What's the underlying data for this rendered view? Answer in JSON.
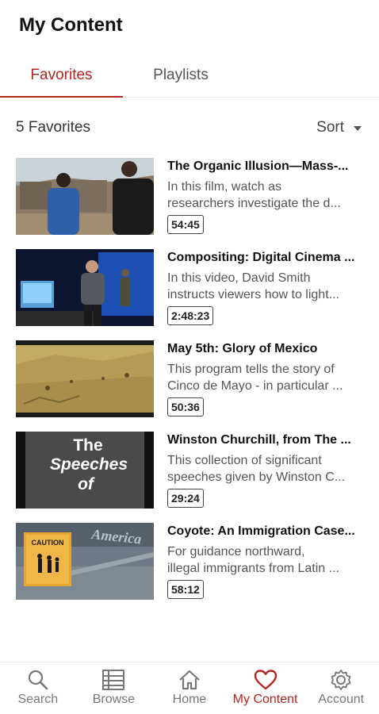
{
  "header": {
    "title": "My Content"
  },
  "tabs": [
    {
      "label": "Favorites",
      "active": true
    },
    {
      "label": "Playlists",
      "active": false
    }
  ],
  "toolbar": {
    "count_label": "5 Favorites",
    "sort_label": "Sort"
  },
  "items": [
    {
      "title": "The Organic Illusion—Mass-...",
      "desc_line1": "In this film, watch as",
      "desc_line2": "researchers investigate the d...",
      "duration": "54:45"
    },
    {
      "title": "Compositing: Digital Cinema ...",
      "desc_line1": "In this video, David Smith",
      "desc_line2": "instructs viewers how to light...",
      "duration": "2:48:23"
    },
    {
      "title": "May 5th: Glory of Mexico",
      "desc_line1": "This program tells the story of",
      "desc_line2": "Cinco de Mayo - in particular ...",
      "duration": "50:36"
    },
    {
      "title": "Winston Churchill, from The ...",
      "desc_line1": "This collection of significant",
      "desc_line2": "speeches given by Winston C...",
      "duration": "29:24",
      "thumb_text": [
        "The",
        "Speeches",
        "of"
      ]
    },
    {
      "title": "Coyote: An Immigration Case...",
      "desc_line1": "For guidance northward,",
      "desc_line2": "illegal immigrants from Latin ...",
      "duration": "58:12",
      "thumb_text": [
        "CAUTION",
        "America"
      ]
    }
  ],
  "nav": [
    {
      "label": "Search",
      "icon": "search-icon",
      "active": false
    },
    {
      "label": "Browse",
      "icon": "browse-icon",
      "active": false
    },
    {
      "label": "Home",
      "icon": "home-icon",
      "active": false
    },
    {
      "label": "My Content",
      "icon": "heart-icon",
      "active": true
    },
    {
      "label": "Account",
      "icon": "gear-icon",
      "active": false
    }
  ],
  "colors": {
    "accent": "#b3261e",
    "text": "#212121",
    "muted": "#777777"
  }
}
